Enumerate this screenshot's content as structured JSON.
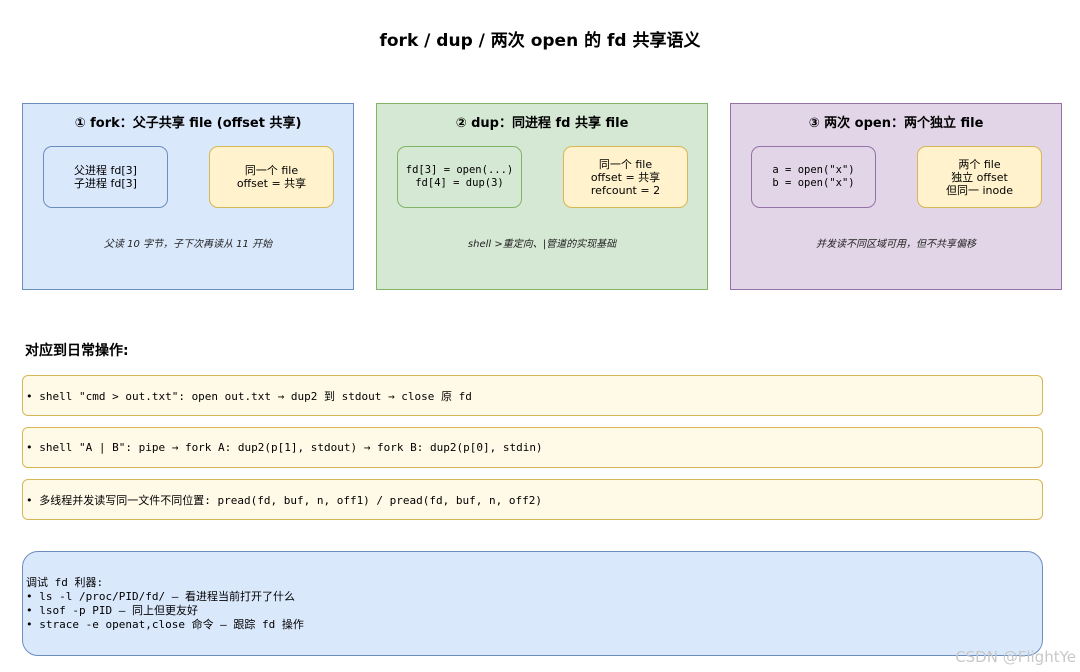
{
  "title": "fork / dup / 两次 open 的 fd 共享语义",
  "panels": [
    {
      "title": "① fork：父子共享 file (offset 共享)",
      "left_box": [
        "父进程 fd[3]",
        "子进程 fd[3]"
      ],
      "right_box": [
        "同一个 file",
        "offset = 共享"
      ],
      "note": "父读 10 字节，子下次再读从 11 开始"
    },
    {
      "title": "② dup：同进程 fd 共享 file",
      "left_box": [
        "fd[3] = open(...)",
        "fd[4] = dup(3)"
      ],
      "right_box": [
        "同一个 file",
        "offset = 共享",
        "refcount = 2"
      ],
      "note": "shell >重定向、|管道的实现基础"
    },
    {
      "title": "③ 两次 open：两个独立 file",
      "left_box": [
        "a = open(\"x\")",
        "b = open(\"x\")"
      ],
      "right_box": [
        "两个 file",
        "独立 offset",
        "但同一 inode"
      ],
      "note": "并发读不同区域可用，但不共享偏移"
    }
  ],
  "section_heading": "对应到日常操作:",
  "operations": [
    "• shell \"cmd > out.txt\": open out.txt → dup2 到 stdout → close 原 fd",
    "• shell \"A | B\": pipe → fork A: dup2(p[1], stdout) → fork B: dup2(p[0], stdin)",
    "• 多线程并发读写同一文件不同位置: pread(fd, buf, n, off1) / pread(fd, buf, n, off2)"
  ],
  "debug": [
    "调试 fd 利器:",
    "• ls -l /proc/PID/fd/ — 看进程当前打开了什么",
    "• lsof -p PID — 同上但更友好",
    "• strace -e openat,close 命令 — 跟踪 fd 操作"
  ],
  "watermark": "CSDN @FlightYe"
}
